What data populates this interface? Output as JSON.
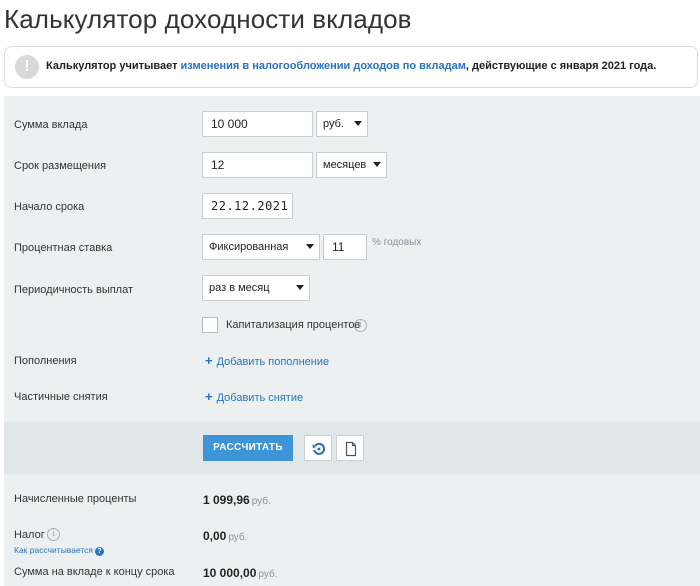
{
  "page": {
    "title": "Калькулятор доходности вкладов"
  },
  "notice": {
    "icon": "exclamation-icon",
    "text_before": "Калькулятор учитывает ",
    "link": "изменения в налогообложении доходов по вкладам",
    "text_after": ", действующие с января 2021 года."
  },
  "form": {
    "amount": {
      "label": "Сумма вклада",
      "value": "10 000",
      "currency": "руб."
    },
    "term": {
      "label": "Срок размещения",
      "value": "12",
      "unit": "месяцев"
    },
    "start": {
      "label": "Начало срока",
      "value": "22.12.2021"
    },
    "rate": {
      "label": "Процентная ставка",
      "type": "Фиксированная",
      "value": "11",
      "unit": "% годовых"
    },
    "payout": {
      "label": "Периодичность выплат",
      "value": "раз в месяц"
    },
    "capitalization": {
      "label": "Капитализация процентов",
      "checked": false
    },
    "deposits": {
      "label": "Пополнения",
      "add": "Добавить пополнение"
    },
    "withdrawals": {
      "label": "Частичные снятия",
      "add": "Добавить снятие"
    }
  },
  "actions": {
    "calculate": "РАССЧИТАТЬ",
    "reset_icon": "reset-icon",
    "document_icon": "document-icon"
  },
  "results": {
    "interest": {
      "label": "Начисленные проценты",
      "value": "1 099,96",
      "unit": "руб."
    },
    "tax": {
      "label": "Налог",
      "value": "0,00",
      "unit": "руб.",
      "how_link": "Как рассчитывается"
    },
    "total": {
      "label": "Сумма на вкладе к концу срока",
      "value": "10 000,00",
      "unit": "руб."
    }
  },
  "colors": {
    "accent": "#3d94d6",
    "link": "#2673c1",
    "panel": "#edf0f1",
    "band": "#e1e6e8"
  }
}
